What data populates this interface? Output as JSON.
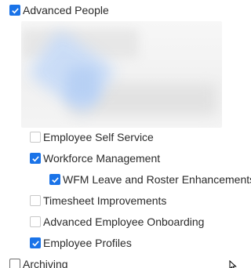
{
  "tree": {
    "advanced_people": {
      "label": "Advanced People",
      "checked": true
    },
    "children": [
      {
        "label": "Employee Self Service",
        "state": "disabled"
      },
      {
        "label": "Workforce Management",
        "state": "checked"
      },
      {
        "label": "WFM Leave and Roster Enhancements",
        "state": "checked"
      },
      {
        "label": "Timesheet Improvements",
        "state": "disabled"
      },
      {
        "label": "Advanced Employee Onboarding",
        "state": "disabled"
      },
      {
        "label": "Employee Profiles",
        "state": "checked"
      }
    ],
    "archiving": {
      "label": "Archiving",
      "checked": false
    }
  },
  "icons": {
    "checkbox_checked": "check-icon",
    "cursor": "mouse-pointer-icon"
  },
  "colors": {
    "checkbox_accent": "#1a73e8",
    "text": "#2b2b2b",
    "disabled_border": "#c8c8c8"
  }
}
